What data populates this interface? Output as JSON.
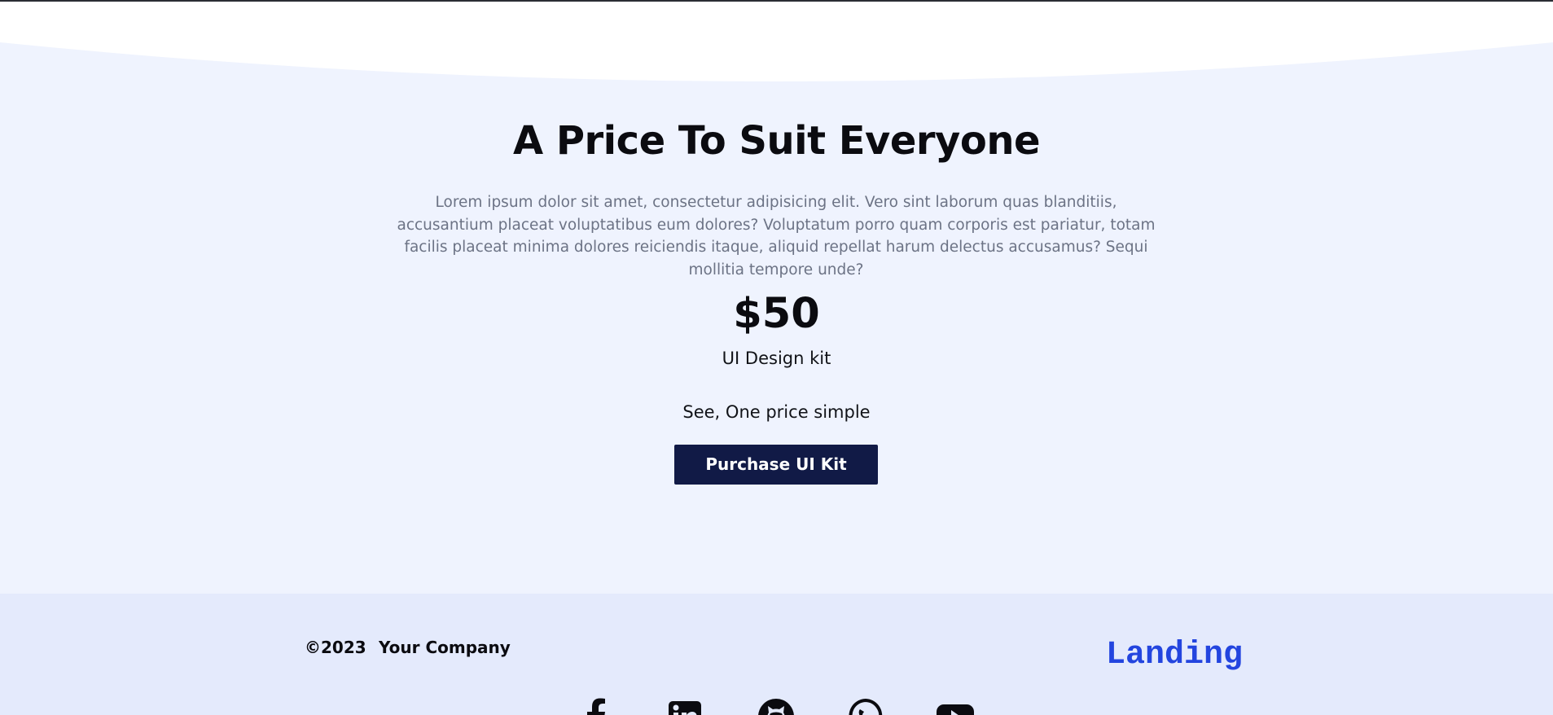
{
  "pricing": {
    "title": "A Price To Suit Everyone",
    "description": "Lorem ipsum dolor sit amet, consectetur adipisicing elit. Vero sint laborum quas blanditiis, accusantium placeat voluptatibus eum dolores? Voluptatum porro quam corporis est pariatur, totam facilis placeat minima dolores reiciendis itaque, aliquid repellat harum delectus accusamus? Sequi mollitia tempore unde?",
    "price": "$50",
    "product": "UI Design kit",
    "tagline": "See, One price simple",
    "purchase_label": "Purchase UI Kit"
  },
  "footer": {
    "copyright": "©2023",
    "company": "Your Company",
    "logo": "Landing",
    "social_icons": [
      "facebook-icon",
      "linkedin-icon",
      "github-icon",
      "whatsapp-icon",
      "youtube-icon"
    ]
  },
  "colors": {
    "page_background": "#eff3fe",
    "footer_background": "#e4eafc",
    "button_background": "#111a46",
    "logo": "#2345df",
    "description_text": "#6c7385"
  }
}
